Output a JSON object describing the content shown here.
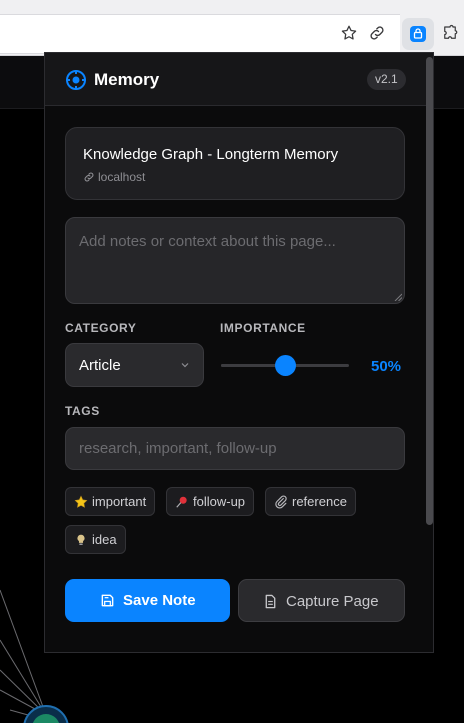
{
  "browser": {
    "icons": [
      "star-icon",
      "link-icon",
      "extension-icon",
      "puzzle-icon"
    ]
  },
  "popup": {
    "title": "Memory",
    "version": "v2.1",
    "page": {
      "title": "Knowledge Graph - Longterm Memory",
      "host": "localhost"
    },
    "notes": {
      "placeholder": "Add notes or context about this page...",
      "value": ""
    },
    "category": {
      "label": "CATEGORY",
      "selected": "Article"
    },
    "importance": {
      "label": "IMPORTANCE",
      "value": 0.5,
      "display": "50%"
    },
    "tags": {
      "label": "TAGS",
      "placeholder": "research, important, follow-up",
      "suggestions": [
        {
          "label": "important",
          "icon": "star-icon"
        },
        {
          "label": "follow-up",
          "icon": "pushpin-icon"
        },
        {
          "label": "reference",
          "icon": "paperclip-icon"
        },
        {
          "label": "idea",
          "icon": "lightbulb-icon"
        }
      ]
    },
    "buttons": {
      "save": "Save Note",
      "capture": "Capture Page"
    }
  },
  "colors": {
    "accent": "#0a84ff",
    "background": "#0b0b0c",
    "surface": "#1f1f22"
  }
}
